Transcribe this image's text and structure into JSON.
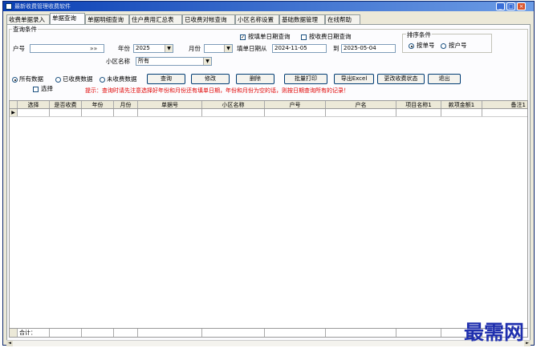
{
  "window": {
    "title": "最新收费管理收费软件"
  },
  "tabs": [
    "收费单据录入",
    "单据查询",
    "单据明细查询",
    "住户费用汇总表",
    "已收费对帐查询",
    "小区名称设置",
    "基础数据管理",
    "在线帮助"
  ],
  "query": {
    "legend": "查询条件",
    "household_label": "户号",
    "household_value": "",
    "household_btn": "»»",
    "year_label": "年份",
    "year_value": "2025",
    "month_label": "月份",
    "month_value": "",
    "by_fill_date_label": "按填单日期查询",
    "by_fill_date_checked": "✓",
    "by_pay_date_label": "按收费日期查询",
    "date_from_label": "填单日期从",
    "date_from": "2024-11-05",
    "date_to_label": "到",
    "date_to": "2025-05-04",
    "community_label": "小区名称",
    "community_value": "所有",
    "sort_legend": "排序条件",
    "sort_by_doc": "按单号",
    "sort_by_house": "按户号",
    "filter_all": "所有数据",
    "filter_paid": "已收费数据",
    "filter_unpaid": "未收费数据",
    "select_label": "选择",
    "hint": "提示：查询时请先注意选择好年份和月份还有填单日期，年份和月份为空的话，则按日期查询所有的记录！"
  },
  "buttons": {
    "query": "查询",
    "edit": "修改",
    "delete": "删除",
    "batch_print": "批量打印",
    "export": "导出Excel",
    "change_status": "更改收费状态",
    "exit": "退出"
  },
  "grid": {
    "columns": [
      "选择",
      "是否收费",
      "年份",
      "月份",
      "单据号",
      "小区名称",
      "户号",
      "户名",
      "项目名称1",
      "款项金额1",
      "备注1"
    ],
    "row_indicator": "▶",
    "summary_label": "合计："
  },
  "icons": {
    "minimize": "_",
    "maximize": "□",
    "close": "×",
    "dropdown": "▼",
    "scroll_left": "◄",
    "scroll_right": "►"
  },
  "watermark": "最需网"
}
